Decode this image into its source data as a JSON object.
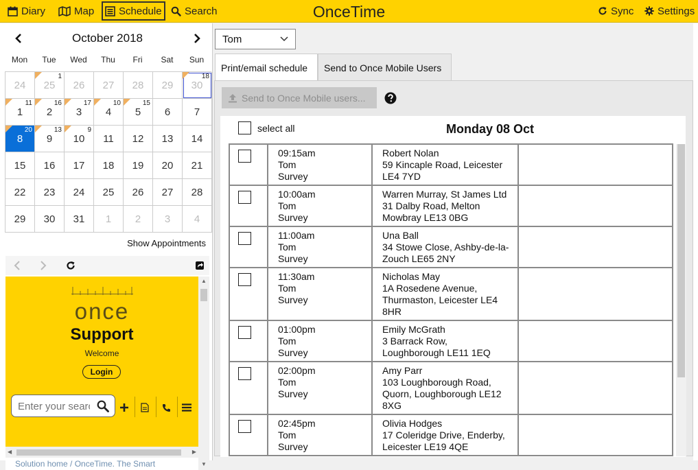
{
  "topbar": {
    "title": "OnceTime",
    "diary": "Diary",
    "map": "Map",
    "schedule": "Schedule",
    "search": "Search",
    "sync": "Sync",
    "settings": "Settings"
  },
  "calendar": {
    "month_label": "October 2018",
    "dow": [
      "Mon",
      "Tue",
      "Wed",
      "Thu",
      "Fri",
      "Sat",
      "Sun"
    ],
    "weeks": [
      [
        {
          "d": "24",
          "out": true
        },
        {
          "d": "25",
          "out": true,
          "c": "1",
          "t": true
        },
        {
          "d": "26",
          "out": true
        },
        {
          "d": "27",
          "out": true
        },
        {
          "d": "28",
          "out": true
        },
        {
          "d": "29",
          "out": true
        },
        {
          "d": "30",
          "out": true,
          "c": "18",
          "t": true,
          "today": true
        }
      ],
      [
        {
          "d": "1",
          "c": "11",
          "t": true
        },
        {
          "d": "2",
          "c": "16",
          "t": true
        },
        {
          "d": "3",
          "c": "17",
          "t": true
        },
        {
          "d": "4",
          "c": "10",
          "t": true
        },
        {
          "d": "5",
          "c": "15",
          "t": true
        },
        {
          "d": "6"
        },
        {
          "d": "7"
        }
      ],
      [
        {
          "d": "8",
          "c": "20",
          "t": true,
          "sel": true
        },
        {
          "d": "9",
          "c": "13",
          "t": true
        },
        {
          "d": "10",
          "c": "9",
          "t": true
        },
        {
          "d": "11"
        },
        {
          "d": "12"
        },
        {
          "d": "13"
        },
        {
          "d": "14"
        }
      ],
      [
        {
          "d": "15"
        },
        {
          "d": "16"
        },
        {
          "d": "17"
        },
        {
          "d": "18"
        },
        {
          "d": "19"
        },
        {
          "d": "20"
        },
        {
          "d": "21"
        }
      ],
      [
        {
          "d": "22"
        },
        {
          "d": "23"
        },
        {
          "d": "24"
        },
        {
          "d": "25"
        },
        {
          "d": "26"
        },
        {
          "d": "27"
        },
        {
          "d": "28"
        }
      ],
      [
        {
          "d": "29"
        },
        {
          "d": "30"
        },
        {
          "d": "31"
        },
        {
          "d": "1",
          "out": true
        },
        {
          "d": "2",
          "out": true
        },
        {
          "d": "3",
          "out": true
        },
        {
          "d": "4",
          "out": true
        }
      ]
    ],
    "show_appointments": "Show Appointments"
  },
  "widget": {
    "logo": "once",
    "heading": "Support",
    "welcome": "Welcome",
    "login": "Login",
    "search_placeholder": "Enter your search",
    "breadcrumb": "Solution home  /  OnceTime. The Smart"
  },
  "schedule": {
    "user": "Tom",
    "tabs": [
      "Print/email schedule",
      "Send to Once Mobile Users"
    ],
    "send_button": "Send to Once Mobile users...",
    "select_all": "select all",
    "day_title": "Monday 08 Oct",
    "appointments": [
      {
        "time": "09:15am",
        "user": "Tom",
        "type": "Survey",
        "customer": [
          "Robert Nolan",
          "59 Kincaple Road, Leicester",
          "LE4 7YD"
        ]
      },
      {
        "time": "10:00am",
        "user": "Tom",
        "type": "Survey",
        "customer": [
          "Warren Murray, St James Ltd",
          "31 Dalby Road, Melton",
          "Mowbray LE13 0BG"
        ]
      },
      {
        "time": "11:00am",
        "user": "Tom",
        "type": "Survey",
        "customer": [
          "Una Ball",
          "34 Stowe Close, Ashby-de-la-",
          "Zouch LE65 2NY"
        ]
      },
      {
        "time": "11:30am",
        "user": "Tom",
        "type": "Survey",
        "customer": [
          "Nicholas May",
          "1A Rosedene Avenue,",
          "Thurmaston, Leicester LE4",
          "8HR"
        ]
      },
      {
        "time": "01:00pm",
        "user": "Tom",
        "type": "Survey",
        "customer": [
          "Emily McGrath",
          "3 Barrack Row,",
          "Loughborough LE11 1EQ"
        ]
      },
      {
        "time": "02:00pm",
        "user": "Tom",
        "type": "Survey",
        "customer": [
          "Amy Parr",
          "103 Loughborough Road,",
          "Quorn, Loughborough LE12",
          "8XG"
        ]
      },
      {
        "time": "02:45pm",
        "user": "Tom",
        "type": "Survey",
        "customer": [
          "Olivia Hodges",
          "17 Coleridge Drive, Enderby,",
          "Leicester LE19 4QE"
        ]
      }
    ]
  },
  "colors": {
    "brand_yellow": "#ffd200",
    "selected_day": "#0a6fd8",
    "appt_marker": "#f0b060"
  }
}
